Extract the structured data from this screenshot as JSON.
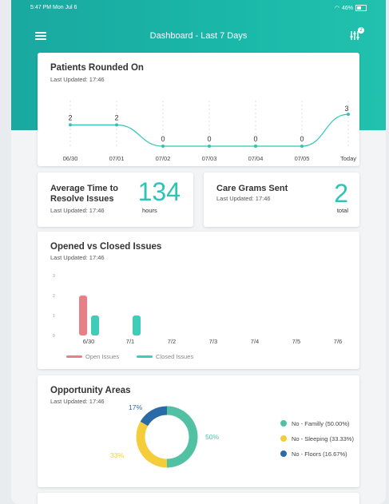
{
  "status_bar": {
    "time": "5:47 PM  Mon Jul 6",
    "battery": "46%"
  },
  "nav": {
    "title": "Dashboard - Last 7 Days",
    "filter_badge": "2"
  },
  "patients": {
    "title": "Patients Rounded On",
    "updated": "Last Updated: 17:46"
  },
  "avg_time": {
    "title_line1": "Average Time to",
    "title_line2": "Resolve Issues",
    "updated": "Last Updated: 17:46",
    "value": "134",
    "unit": "hours"
  },
  "care_grams": {
    "title": "Care Grams Sent",
    "updated": "Last Updated: 17:46",
    "value": "2",
    "unit": "total"
  },
  "issues": {
    "title": "Opened vs Closed Issues",
    "updated": "Last Updated: 17:46"
  },
  "opportunity": {
    "title": "Opportunity Areas",
    "updated": "Last Updated: 17:46"
  },
  "chart_data": [
    {
      "type": "line",
      "title": "Patients Rounded On",
      "categories": [
        "06/30",
        "07/01",
        "07/02",
        "07/03",
        "07/04",
        "07/05",
        "Today"
      ],
      "values": [
        2,
        2,
        0,
        0,
        0,
        0,
        3
      ],
      "color": "#2cc5b5"
    },
    {
      "type": "bar",
      "title": "Opened vs Closed Issues",
      "categories": [
        "6/30",
        "7/1",
        "7/2",
        "7/3",
        "7/4",
        "7/5",
        "7/6"
      ],
      "ylim": [
        0,
        3
      ],
      "yticks": [
        "0",
        "1",
        "2",
        "3"
      ],
      "series": [
        {
          "name": "Open Issues",
          "color": "#e97f86",
          "values": [
            2,
            0,
            0,
            0,
            0,
            0,
            0
          ]
        },
        {
          "name": "Closed Issues",
          "color": "#3dcdb8",
          "values": [
            1,
            1,
            0,
            0,
            0,
            0,
            0
          ]
        }
      ]
    },
    {
      "type": "pie",
      "title": "Opportunity Areas",
      "slices": [
        {
          "label": "No - Familly (50.00%)",
          "value": 50,
          "pct_label": "50%",
          "color": "#52c1a3"
        },
        {
          "label": "No - Sleeping (33.33%)",
          "value": 33.33,
          "pct_label": "33%",
          "color": "#f5cd3a"
        },
        {
          "label": "No - Floors (16.67%)",
          "value": 16.67,
          "pct_label": "17%",
          "color": "#2a6aa6"
        }
      ]
    }
  ]
}
